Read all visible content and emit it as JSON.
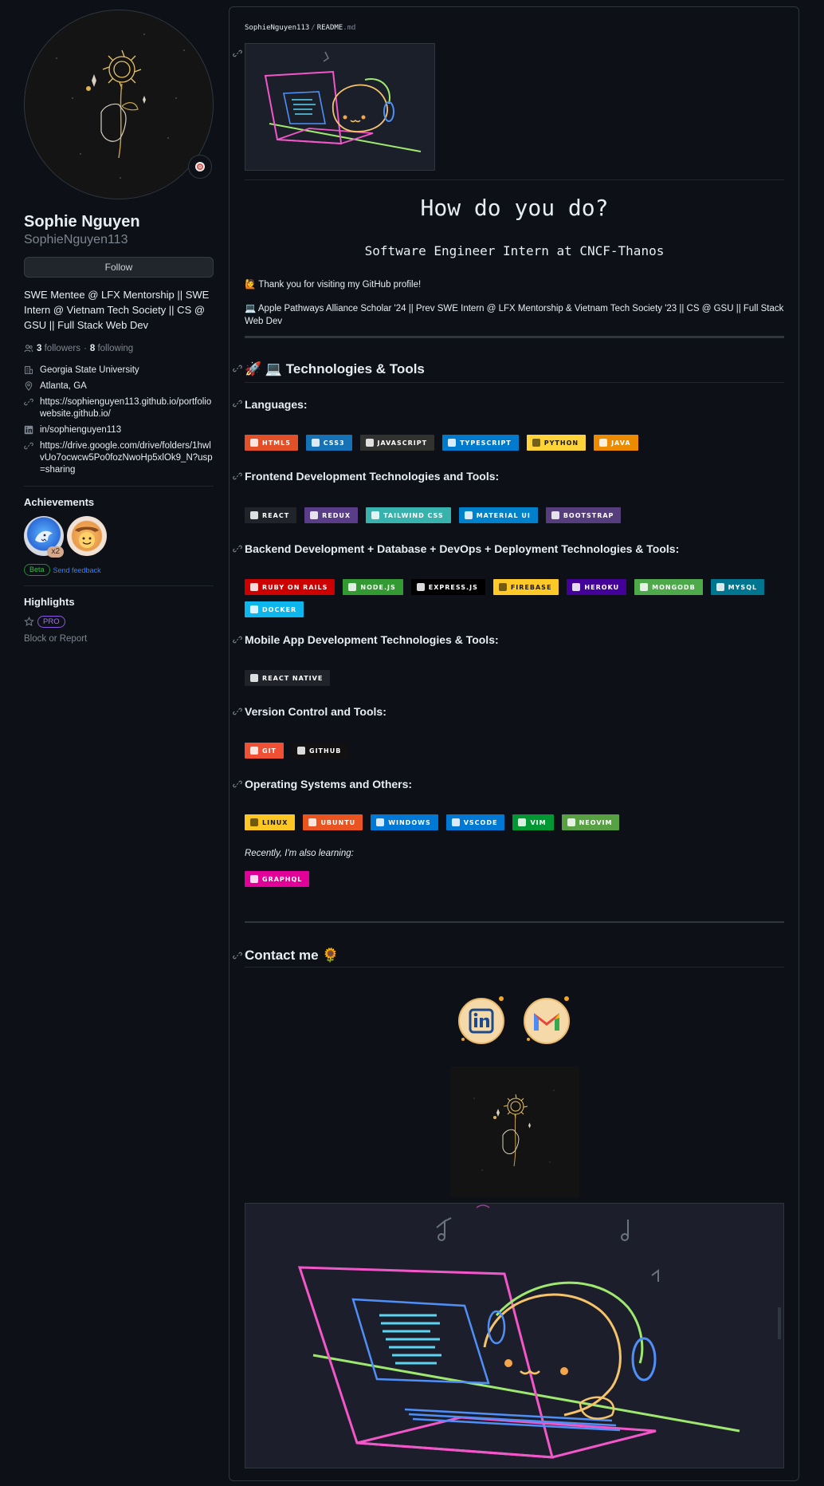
{
  "profile": {
    "name": "Sophie Nguyen",
    "username": "SophieNguyen113",
    "follow_label": "Follow",
    "bio": "SWE Mentee @ LFX Mentorship || SWE Intern @ Vietnam Tech Society || CS @ GSU || Full Stack Web Dev",
    "followers_count": "3",
    "followers_label": "followers",
    "following_count": "8",
    "following_label": "following",
    "dot": "·",
    "details": [
      {
        "icon": "organization-icon",
        "text": "Georgia State University"
      },
      {
        "icon": "location-icon",
        "text": "Atlanta, GA"
      },
      {
        "icon": "link-icon",
        "text": "https://sophienguyen113.github.io/portfoliowebsite.github.io/"
      },
      {
        "icon": "linkedin-icon",
        "text": "in/sophienguyen113"
      },
      {
        "icon": "link-icon",
        "text": "https://drive.google.com/drive/folders/1hwlvUo7ocwcw5Po0fozNwoHp5xlOk9_N?usp=sharing"
      }
    ],
    "achievements_title": "Achievements",
    "achievement_count": "x2",
    "beta_label": "Beta",
    "feedback_label": "Send feedback",
    "highlights_title": "Highlights",
    "pro_label": "PRO",
    "block_label": "Block or Report"
  },
  "readme": {
    "breadcrumb_user": "SophieNguyen113",
    "breadcrumb_sep": "/",
    "breadcrumb_file": "README",
    "breadcrumb_ext": ".md",
    "title": "How do you do?",
    "subtitle": "Software Engineer Intern at CNCF-Thanos",
    "greeting": "🙋 Thank you for visiting my GitHub profile!",
    "intro": "💻 Apple Pathways Alliance Scholar '24 || Prev SWE Intern @ LFX Mentorship & Vietnam Tech Society '23 || CS @ GSU || Full Stack Web Dev",
    "tech_heading": "🚀 💻 Technologies & Tools",
    "sections": {
      "languages": {
        "heading": "Languages:",
        "badges": [
          {
            "label": "HTML5",
            "color": "#e34f26"
          },
          {
            "label": "CSS3",
            "color": "#1572b6"
          },
          {
            "label": "JAVASCRIPT",
            "color": "#323330"
          },
          {
            "label": "TYPESCRIPT",
            "color": "#007acc"
          },
          {
            "label": "PYTHON",
            "color": "#ffd43b"
          },
          {
            "label": "JAVA",
            "color": "#ed8b00"
          }
        ]
      },
      "frontend": {
        "heading": "Frontend Development Technologies and Tools:",
        "badges": [
          {
            "label": "REACT",
            "color": "#20232a"
          },
          {
            "label": "REDUX",
            "color": "#593d88"
          },
          {
            "label": "TAILWIND CSS",
            "color": "#38b2ac"
          },
          {
            "label": "MATERIAL UI",
            "color": "#0081cb"
          },
          {
            "label": "BOOTSTRAP",
            "color": "#563d7c"
          }
        ]
      },
      "backend": {
        "heading": "Backend Development + Database + DevOps + Deployment Technologies & Tools:",
        "badges": [
          {
            "label": "RUBY ON RAILS",
            "color": "#cc0000"
          },
          {
            "label": "NODE.JS",
            "color": "#339933"
          },
          {
            "label": "EXPRESS.JS",
            "color": "#000000"
          },
          {
            "label": "FIREBASE",
            "color": "#ffca28"
          },
          {
            "label": "HEROKU",
            "color": "#430098"
          },
          {
            "label": "MONGODB",
            "color": "#4ea94b"
          },
          {
            "label": "MYSQL",
            "color": "#00758f"
          },
          {
            "label": "DOCKER",
            "color": "#0db7ed"
          }
        ]
      },
      "mobile": {
        "heading": "Mobile App Development Technologies & Tools:",
        "badges": [
          {
            "label": "REACT NATIVE",
            "color": "#20232a"
          }
        ]
      },
      "vcs": {
        "heading": "Version Control and Tools:",
        "badges": [
          {
            "label": "GIT",
            "color": "#f05033"
          },
          {
            "label": "GITHUB",
            "color": "#121011"
          }
        ]
      },
      "os": {
        "heading": "Operating Systems and Others:",
        "badges": [
          {
            "label": "LINUX",
            "color": "#fcc624"
          },
          {
            "label": "UBUNTU",
            "color": "#e95420"
          },
          {
            "label": "WINDOWS",
            "color": "#0078d6"
          },
          {
            "label": "VSCODE",
            "color": "#0078d4"
          },
          {
            "label": "VIM",
            "color": "#019733"
          },
          {
            "label": "NEOVIM",
            "color": "#57a143"
          }
        ]
      }
    },
    "learning_label": "Recently, I'm also learning:",
    "learning_badges": [
      {
        "label": "GRAPHQL",
        "color": "#e10098"
      }
    ],
    "contact_heading": "Contact me 🌻"
  }
}
